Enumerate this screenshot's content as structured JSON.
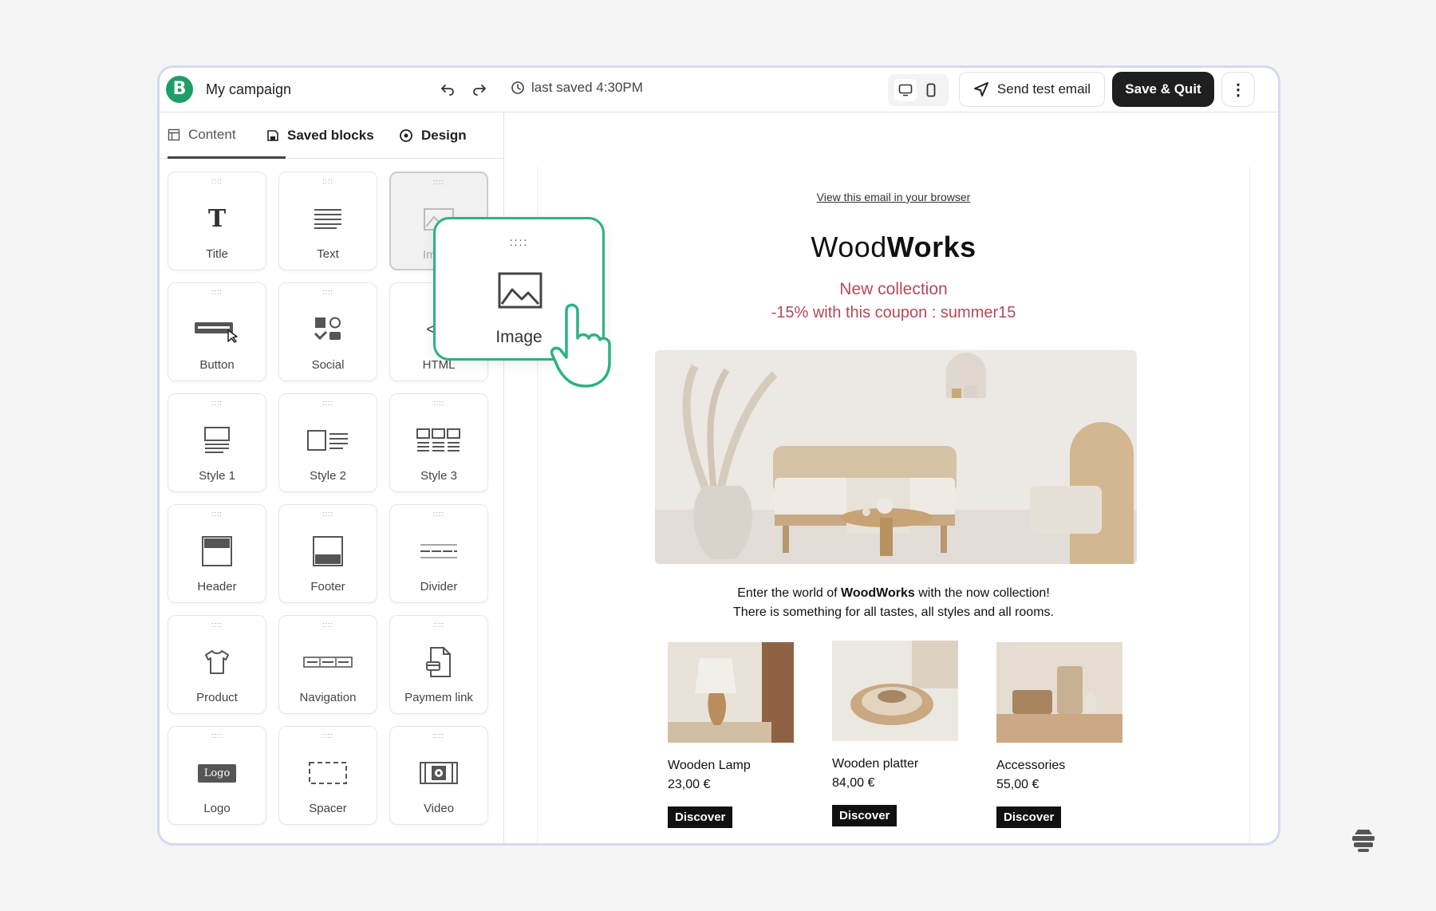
{
  "topbar": {
    "logo_letter": "B",
    "campaign_name": "My campaign",
    "last_saved": "last saved 4:30PM",
    "send_test": "Send test email",
    "save_quit": "Save & Quit",
    "more": "⋮"
  },
  "sidebar": {
    "tabs": [
      {
        "label": "Content"
      },
      {
        "label": "Saved blocks"
      },
      {
        "label": "Design"
      }
    ],
    "grip": "::::",
    "blocks": [
      {
        "label": "Title",
        "icon": "title-icon"
      },
      {
        "label": "Text",
        "icon": "text-icon"
      },
      {
        "label": "Im",
        "icon": "image-icon"
      },
      {
        "label": "Button",
        "icon": "button-icon"
      },
      {
        "label": "Social",
        "icon": "social-icon"
      },
      {
        "label": "HTML",
        "icon": "html-icon"
      },
      {
        "label": "Style 1",
        "icon": "style1-icon"
      },
      {
        "label": "Style 2",
        "icon": "style2-icon"
      },
      {
        "label": "Style 3",
        "icon": "style3-icon"
      },
      {
        "label": "Header",
        "icon": "header-icon"
      },
      {
        "label": "Footer",
        "icon": "footer-icon"
      },
      {
        "label": "Divider",
        "icon": "divider-icon"
      },
      {
        "label": "Product",
        "icon": "tshirt-icon"
      },
      {
        "label": "Navigation",
        "icon": "navigation-icon"
      },
      {
        "label": "Paymem link",
        "icon": "payment-link-icon"
      },
      {
        "label": "Logo",
        "icon": "logo-icon",
        "badge": "Logo"
      },
      {
        "label": "Spacer",
        "icon": "spacer-icon"
      },
      {
        "label": "Video",
        "icon": "video-icon"
      }
    ]
  },
  "drag_card": {
    "grip": "::::",
    "label": "Image"
  },
  "email": {
    "view_link": "View this email in your browser",
    "brand_regular": "Wood",
    "brand_bold": "Works",
    "promo_line1": "New collection",
    "promo_line2": "-15% with this coupon : summer15",
    "intro_line1_a": "Enter the world of ",
    "intro_line1_b": "WoodWorks",
    "intro_line1_c": " with the now collection!",
    "intro_line2": "There is something for all tastes, all styles and all rooms.",
    "products": [
      {
        "name": "Wooden Lamp",
        "price": "23,00 €",
        "button": "Discover"
      },
      {
        "name": "Wooden platter",
        "price": "84,00 €",
        "button": "Discover"
      },
      {
        "name": "Accessories",
        "price": "55,00 €",
        "button": "Discover"
      }
    ]
  },
  "colors": {
    "brand_green": "#1f9e6a",
    "drag_border": "#2bb286",
    "promo_red": "#b24a5a",
    "dark_button": "#1f1f1f"
  }
}
